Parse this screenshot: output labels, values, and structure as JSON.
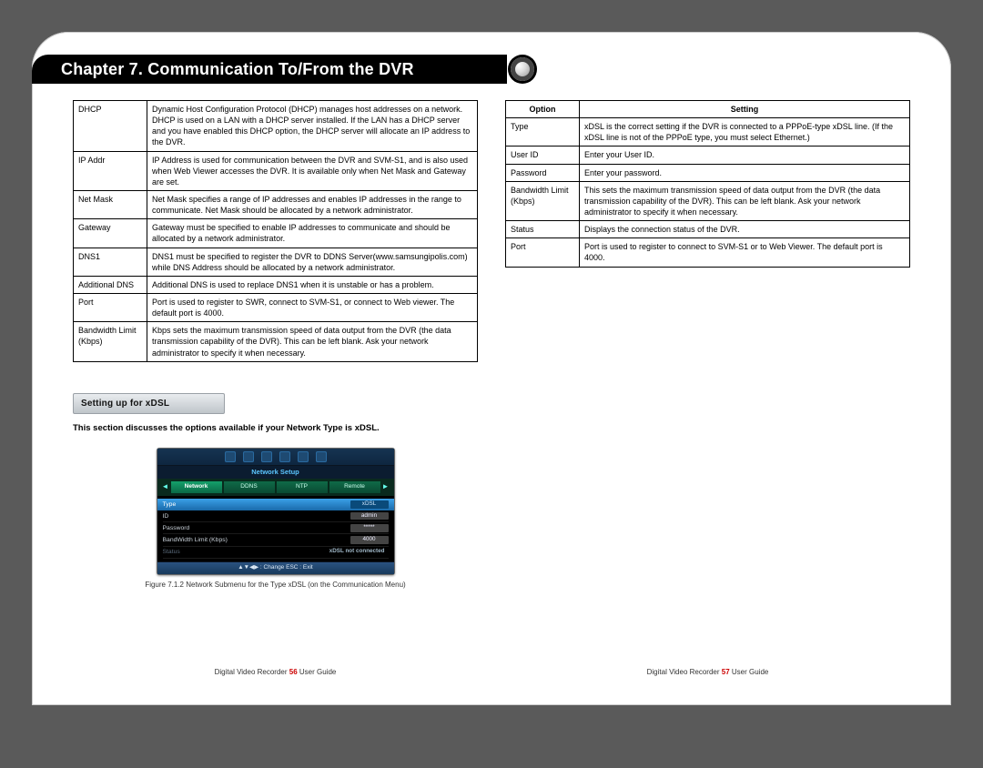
{
  "chapter_title": "Chapter 7. Communication To/From the DVR",
  "left_table": {
    "rows": [
      {
        "opt": "DHCP",
        "desc": "Dynamic Host Configuration Protocol (DHCP) manages host addresses on a network. DHCP is used on a LAN with a DHCP server installed. If the LAN has a DHCP server and you have enabled this DHCP option, the DHCP server will allocate an IP address to the DVR."
      },
      {
        "opt": "IP Addr",
        "desc": "IP Address is used for communication between the DVR and SVM-S1, and is also used when Web Viewer accesses the DVR. It is available only when Net Mask and Gateway are set."
      },
      {
        "opt": "Net Mask",
        "desc": "Net Mask specifies a range of IP addresses and enables IP addresses in the range to communicate. Net Mask should be allocated by a network administrator."
      },
      {
        "opt": "Gateway",
        "desc": "Gateway must be specified to enable IP addresses to communicate and should be allocated by a network administrator."
      },
      {
        "opt": "DNS1",
        "desc": "DNS1 must be specified to register the DVR to DDNS Server(www.samsungipolis.com) while DNS Address should be allocated by a network administrator."
      },
      {
        "opt": "Additional DNS",
        "desc": "Additional DNS is used to replace DNS1 when it is unstable or has a problem."
      },
      {
        "opt": "Port",
        "desc": "Port is used to register to SWR, connect to SVM-S1, or connect to Web viewer. The default port is 4000."
      },
      {
        "opt": "Bandwidth Limit (Kbps)",
        "desc": "Kbps sets the maximum transmission speed of data output from the DVR (the data transmission capability of the DVR). This can be left blank. Ask your network administrator to specify it when necessary."
      }
    ]
  },
  "section_title": "Setting up for xDSL",
  "section_intro": "This section discusses the options available if your Network Type is xDSL.",
  "dvr": {
    "title": "Network Setup",
    "tabs": [
      "Network",
      "DDNS",
      "NTP",
      "Remote"
    ],
    "rows": [
      {
        "label": "Type",
        "value": "xDSL",
        "hl": true
      },
      {
        "label": "ID",
        "value": "admin"
      },
      {
        "label": "Password",
        "value": "*****"
      },
      {
        "label": "BandWidth Limit (Kbps)",
        "value": "4000"
      },
      {
        "label": "Status",
        "value": "xDSL not connected",
        "status": true
      }
    ],
    "footer": "▲▼◀▶ : Change     ESC : Exit"
  },
  "figure_caption": "Figure 7.1.2 Network Submenu for the Type xDSL (on the Communication Menu)",
  "right_table": {
    "headers": [
      "Option",
      "Setting"
    ],
    "rows": [
      {
        "opt": "Type",
        "desc": "xDSL is the correct setting if the DVR is connected to a PPPoE-type xDSL line. (If the xDSL line is not of the PPPoE type, you must select Ethernet.)"
      },
      {
        "opt": "User ID",
        "desc": "Enter your User ID."
      },
      {
        "opt": "Password",
        "desc": "Enter your password."
      },
      {
        "opt": "Bandwidth Limit (Kbps)",
        "desc": "This sets the maximum transmission speed of data output from the DVR (the data transmission capability of the DVR). This can be left blank. Ask your network administrator to specify it when necessary."
      },
      {
        "opt": "Status",
        "desc": "Displays the connection status of the DVR."
      },
      {
        "opt": "Port",
        "desc": "Port is used to register to connect to SVM-S1 or to Web Viewer. The default port is 4000."
      }
    ]
  },
  "footer": {
    "left": {
      "pre": "Digital Video Recorder",
      "pg": "56",
      "post": "User Guide"
    },
    "right": {
      "pre": "Digital Video Recorder",
      "pg": "57",
      "post": "User Guide"
    }
  }
}
